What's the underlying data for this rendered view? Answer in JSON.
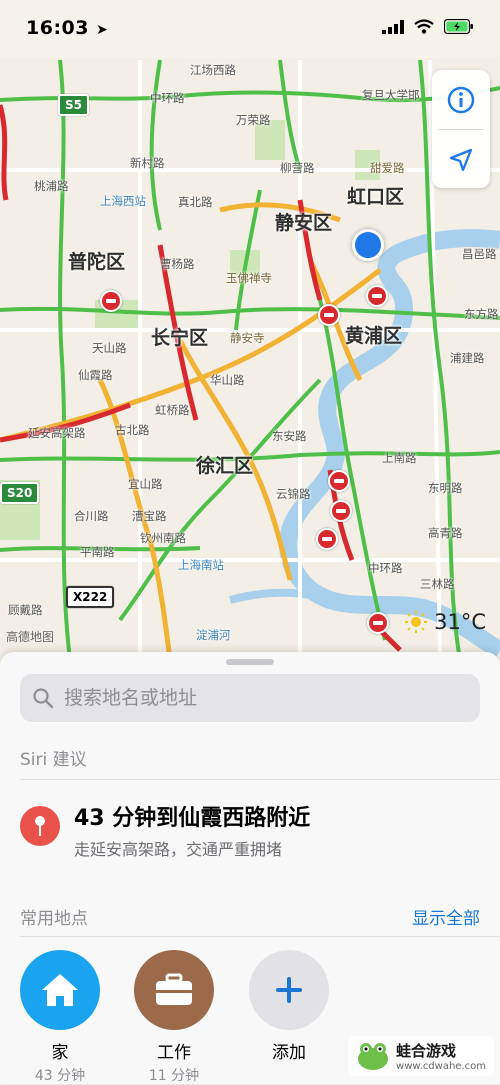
{
  "status_bar": {
    "time": "16:03"
  },
  "map": {
    "districts": [
      "虹口区",
      "静安区",
      "普陀区",
      "长宁区",
      "黄浦区",
      "徐汇区"
    ],
    "roads": [
      "江场西路",
      "中环路",
      "复旦大学邯",
      "万荣路",
      "新村路",
      "桃浦路",
      "上海西站",
      "真北路",
      "柳营路",
      "甜爱路",
      "曹杨路",
      "玉佛禅寺",
      "静安寺",
      "天山路",
      "仙霞路",
      "延安高架路",
      "虹桥路",
      "古北路",
      "华山路",
      "宜山路",
      "漕宝路",
      "钦州南路",
      "平南路",
      "合川路",
      "上海南站",
      "东安路",
      "云锦路",
      "中环路",
      "上南路",
      "东明路",
      "高青路",
      "三林路",
      "淀浦河",
      "顾戴路",
      "浦建路",
      "昌邑路",
      "东方路"
    ],
    "shields": [
      "S5",
      "S20",
      "X222"
    ],
    "weather": {
      "temp": "31°C"
    },
    "attribution": "高德地图"
  },
  "sheet": {
    "search_placeholder": "搜索地名或地址",
    "siri_section": "Siri 建议",
    "siri_title": "43 分钟到仙霞西路附近",
    "siri_subtitle": "走延安高架路，交通严重拥堵",
    "favorites_section": "常用地点",
    "show_all": "显示全部",
    "favorites": [
      {
        "label": "家",
        "sub": "43 分钟",
        "color": "#1aa3ee",
        "icon": "home-icon"
      },
      {
        "label": "工作",
        "sub": "11 分钟",
        "color": "#9a6a4a",
        "icon": "briefcase-icon"
      },
      {
        "label": "添加",
        "sub": "",
        "color": "#e2e2e6",
        "icon": "plus-icon"
      }
    ]
  },
  "watermark": {
    "name": "蛙合游戏",
    "url": "www.cdwahe.com"
  }
}
